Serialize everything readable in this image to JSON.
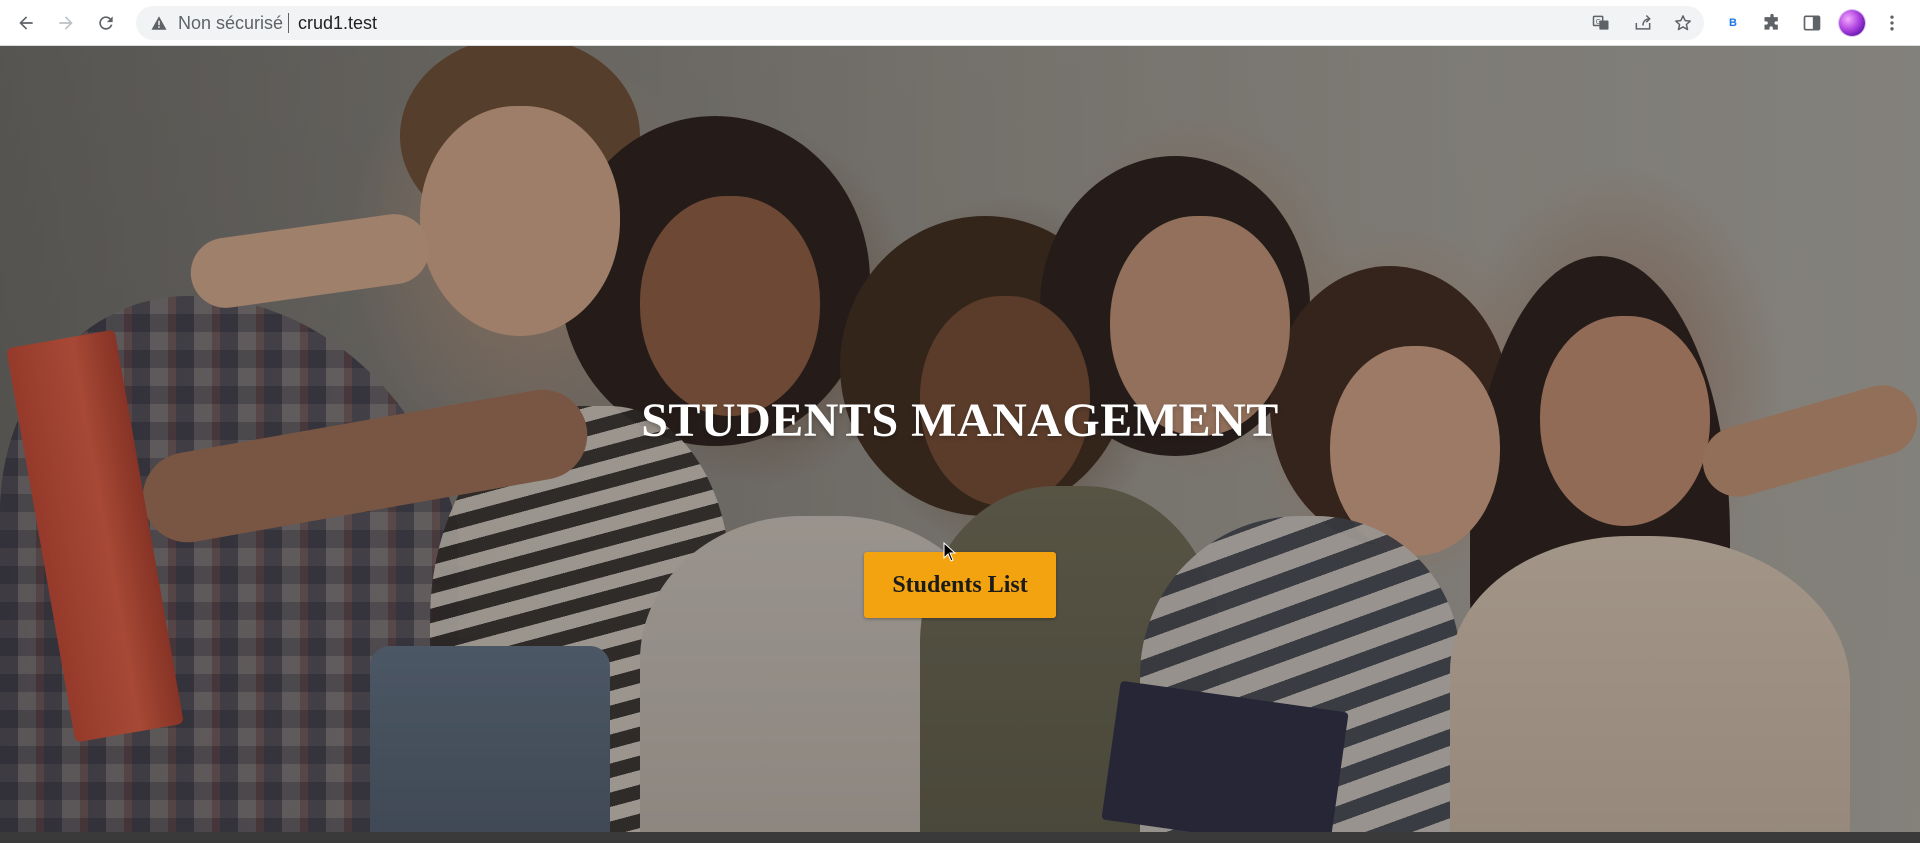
{
  "browser": {
    "security_label": "Non sécurisé",
    "url": "crud1.test",
    "icons": {
      "back": "back-arrow-icon",
      "forward": "forward-arrow-icon",
      "reload": "reload-icon",
      "warning": "warning-icon",
      "translate": "translate-icon",
      "share": "share-icon",
      "bookmark": "star-icon",
      "extension_b": "extension-b-icon",
      "extensions": "puzzle-icon",
      "side_panel": "side-panel-icon",
      "profile": "profile-avatar",
      "menu": "kebab-menu-icon"
    },
    "extension_b_label": "B"
  },
  "hero": {
    "title": "STUDENTS MANAGEMENT",
    "button_label": "Students List",
    "button_color": "#f2a30f"
  }
}
